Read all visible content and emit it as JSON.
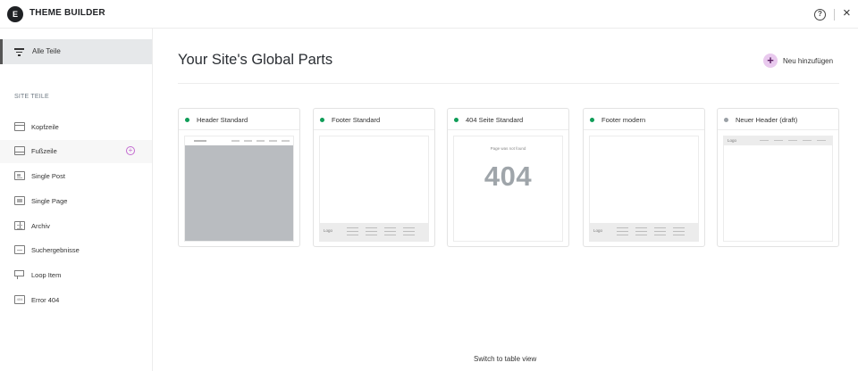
{
  "app": {
    "logo_glyph": "E",
    "title": "THEME BUILDER",
    "help_glyph": "?",
    "close_glyph": "×"
  },
  "sidebar": {
    "all_parts_label": "Alle Teile",
    "section_title": "SITE TEILE",
    "items": [
      {
        "label": "Kopfzeile",
        "icon": "header-icon"
      },
      {
        "label": "Fußzeile",
        "icon": "footer-icon",
        "add_glyph": "+"
      },
      {
        "label": "Single Post",
        "icon": "single-post-icon"
      },
      {
        "label": "Single Page",
        "icon": "single-page-icon"
      },
      {
        "label": "Archiv",
        "icon": "archive-icon"
      },
      {
        "label": "Suchergebnisse",
        "icon": "search-results-icon"
      },
      {
        "label": "Loop Item",
        "icon": "loop-item-icon"
      },
      {
        "label": "Error 404",
        "icon": "error-404-icon",
        "icon_text": "404"
      }
    ]
  },
  "main": {
    "title": "Your Site's Global Parts",
    "add_new": {
      "glyph": "+",
      "label": "Neu hinzufügen"
    },
    "cards": [
      {
        "title": "Header Standard",
        "status": "published"
      },
      {
        "title": "Footer Standard",
        "status": "published",
        "preview_logo": "Logo"
      },
      {
        "title": "404 Seite Standard",
        "status": "published",
        "preview_small": "Page was not found",
        "preview_big": "404"
      },
      {
        "title": "Footer modern",
        "status": "published",
        "preview_logo": "Logo"
      },
      {
        "title": "Neuer Header (draft)",
        "status": "draft",
        "preview_logo": "Logo"
      }
    ],
    "switch_view_label": "Switch to table view"
  },
  "colors": {
    "published": "#0f9d58",
    "draft": "#9aa0a6",
    "accent": "#c36bd0"
  }
}
